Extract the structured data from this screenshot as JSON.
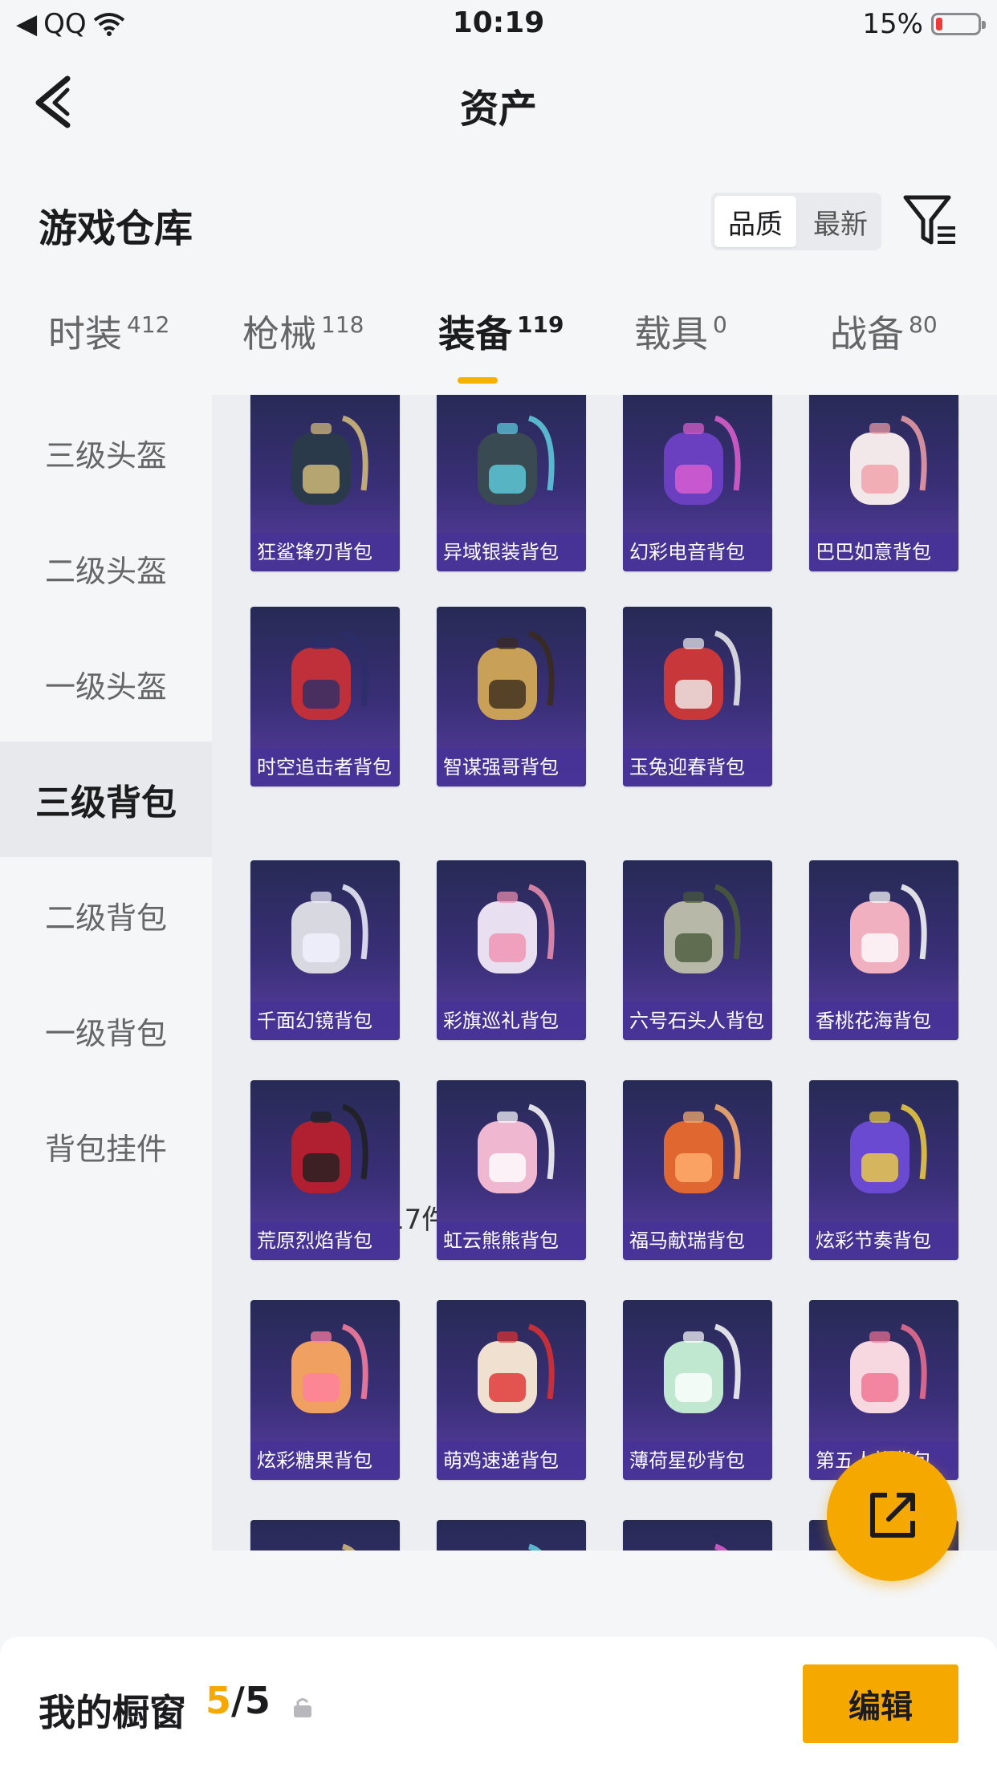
{
  "status": {
    "carrier": "QQ",
    "time": "10:19",
    "battery": "15%",
    "battery_level": 0.15
  },
  "header": {
    "title": "资产"
  },
  "warehouse": {
    "title": "游戏仓库",
    "sort_quality": "品质",
    "sort_newest": "最新"
  },
  "tabs": [
    {
      "label": "时装",
      "count": "412"
    },
    {
      "label": "枪械",
      "count": "118"
    },
    {
      "label": "装备",
      "count": "119"
    },
    {
      "label": "载具",
      "count": "0"
    },
    {
      "label": "战备",
      "count": "80"
    }
  ],
  "sidenav": [
    "三级头盔",
    "二级头盔",
    "一级头盔",
    "三级背包",
    "二级背包",
    "一级背包",
    "背包挂件"
  ],
  "level3_items": [
    {
      "name": "狂鲨锋刃背包"
    },
    {
      "name": "异域银装背包"
    },
    {
      "name": "幻彩电音背包"
    },
    {
      "name": "巴巴如意背包"
    },
    {
      "name": "时空追击者背包"
    },
    {
      "name": "智谋强哥背包"
    },
    {
      "name": "玉兔迎春背包"
    }
  ],
  "level2": {
    "section_label": "二级背包：17件"
  },
  "level2_items": [
    {
      "name": "千面幻镜背包"
    },
    {
      "name": "彩旗巡礼背包"
    },
    {
      "name": "六号石头人背包"
    },
    {
      "name": "香桃花海背包"
    },
    {
      "name": "荒原烈焰背包"
    },
    {
      "name": "虹云熊熊背包"
    },
    {
      "name": "福马献瑞背包"
    },
    {
      "name": "炫彩节奏背包"
    },
    {
      "name": "炫彩糖果背包"
    },
    {
      "name": "萌鸡速递背包"
    },
    {
      "name": "薄荷星砂背包"
    },
    {
      "name": "第五人格背包"
    }
  ],
  "bottom": {
    "label": "我的橱窗",
    "current": "5",
    "total": "/5",
    "edit": "编辑"
  }
}
